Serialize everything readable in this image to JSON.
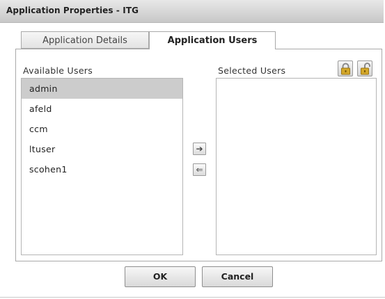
{
  "window": {
    "title": "Application Properties - ITG"
  },
  "tabs": [
    {
      "label": "Application Details",
      "active": false
    },
    {
      "label": "Application Users",
      "active": true
    }
  ],
  "available_users": {
    "label": "Available Users",
    "items": [
      "admin",
      "afeld",
      "ccm",
      "ltuser",
      "scohen1"
    ],
    "selected": "admin"
  },
  "selected_users": {
    "label": "Selected Users",
    "items": []
  },
  "transfer": {
    "add_icon": "arrow-right-icon",
    "remove_icon": "arrow-left-icon",
    "add_glyph": "➔",
    "remove_glyph": "⇐"
  },
  "lock_buttons": [
    {
      "icon": "lock-icon"
    },
    {
      "icon": "unlock-icon"
    }
  ],
  "buttons": {
    "ok": "OK",
    "cancel": "Cancel"
  },
  "colors": {
    "selected_row": "#cccccc",
    "lock_gold": "#d4a82a"
  }
}
